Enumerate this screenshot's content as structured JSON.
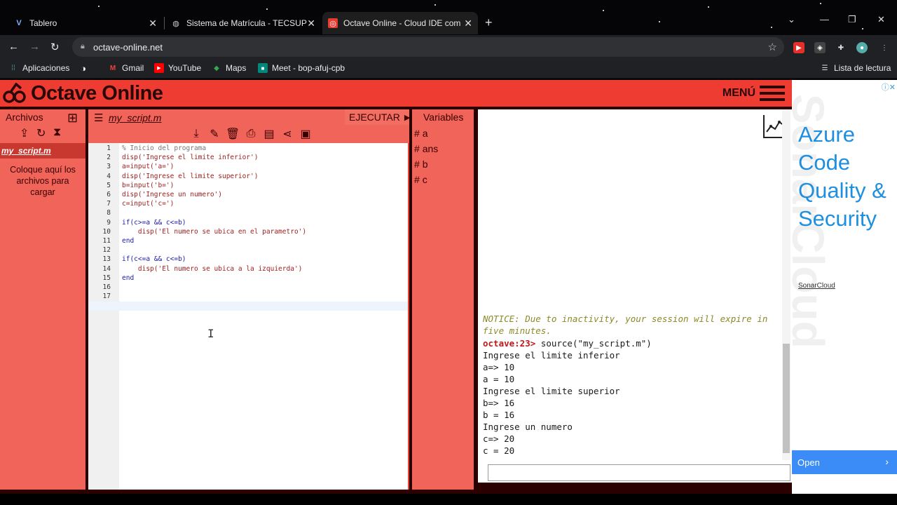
{
  "browser": {
    "tabs": [
      {
        "title": "Tablero",
        "favicon": "v-icon",
        "active": false
      },
      {
        "title": "Sistema de Matrícula - TECSUP",
        "favicon": "globe-icon",
        "active": false
      },
      {
        "title": "Octave Online - Cloud IDE compa",
        "favicon": "octave-icon",
        "active": true
      }
    ],
    "url": "octave-online.net",
    "bookmarks": [
      {
        "label": "Aplicaciones",
        "icon": "apps-grid-icon"
      },
      {
        "label": "",
        "icon": "globe-icon"
      },
      {
        "label": "Gmail",
        "icon": "gmail-icon"
      },
      {
        "label": "YouTube",
        "icon": "youtube-icon"
      },
      {
        "label": "Maps",
        "icon": "maps-icon"
      },
      {
        "label": "Meet - bop-afuj-cpb",
        "icon": "meet-icon"
      }
    ],
    "reading_list": "Lista de lectura"
  },
  "app": {
    "logo": "Octave Online",
    "menu_label": "MENÚ",
    "files": {
      "title": "Archivos",
      "active_file": "my_script.m",
      "drop_message": "Coloque aquí los archivos para cargar"
    },
    "editor": {
      "filename": "my_script.m",
      "run_label": "EJECUTAR",
      "lines": [
        {
          "n": "1",
          "text": "% Inicio del programa",
          "kind": "cm"
        },
        {
          "n": "2",
          "text": "disp('Ingrese el limite inferior')",
          "kind": "str"
        },
        {
          "n": "3",
          "text": "a=input('a=')",
          "kind": "str"
        },
        {
          "n": "4",
          "text": "disp('Ingrese el limite superior')",
          "kind": "str"
        },
        {
          "n": "5",
          "text": "b=input('b=')",
          "kind": "str"
        },
        {
          "n": "6",
          "text": "disp('Ingrese un numero')",
          "kind": "str"
        },
        {
          "n": "7",
          "text": "c=input('c=')",
          "kind": "str"
        },
        {
          "n": "8",
          "text": "",
          "kind": "str"
        },
        {
          "n": "9",
          "text": "if(c>=a && c<=b)",
          "kind": "kw"
        },
        {
          "n": "10",
          "text": "    disp('El numero se ubica en el parametro')",
          "kind": "str"
        },
        {
          "n": "11",
          "text": "end",
          "kind": "kw"
        },
        {
          "n": "12",
          "text": "",
          "kind": "str"
        },
        {
          "n": "13",
          "text": "if(c<=a && c<=b)",
          "kind": "kw"
        },
        {
          "n": "14",
          "text": "    disp('El numero se ubica a la izquierda')",
          "kind": "str"
        },
        {
          "n": "15",
          "text": "end",
          "kind": "kw"
        },
        {
          "n": "16",
          "text": "",
          "kind": "str"
        },
        {
          "n": "17",
          "text": "",
          "kind": "str"
        },
        {
          "n": "18",
          "text": "",
          "kind": "str"
        }
      ]
    },
    "variables": {
      "title": "Variables",
      "items": [
        "a",
        "ans",
        "b",
        "c"
      ]
    },
    "console": {
      "notice": "NOTICE: Due to inactivity, your session will expire in five minutes.",
      "prompt": "octave:23>",
      "command": " source(\"my_script.m\")",
      "output": [
        "Ingrese el limite inferior",
        "a=> 10",
        "a = 10",
        "Ingrese el limite superior",
        "b=> 16",
        "b = 16",
        "Ingrese un numero",
        "c=> 20",
        "c = 20"
      ],
      "input_prompt": "❯"
    }
  },
  "ad": {
    "headline": "Azure Code Quality & Security",
    "brand": "SonarCloud",
    "cta": "Open"
  }
}
